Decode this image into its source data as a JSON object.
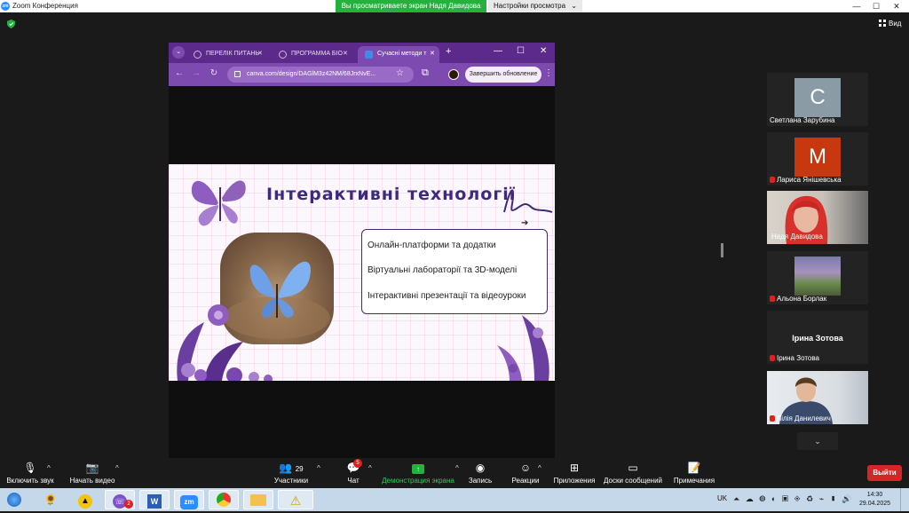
{
  "window": {
    "title": "Zoom Конференция",
    "share_banner": "Вы просматриваете экран Надя Давидова",
    "view_options": "Настройки просмотра",
    "minimize": "—",
    "maximize": "☐",
    "close": "✕"
  },
  "topbar": {
    "view_label": "Вид"
  },
  "browser": {
    "tabs": [
      {
        "label": "ПЕРЕЛІК ПИТАНЬ",
        "close": "✕"
      },
      {
        "label": "ПРОГРАММА БІО",
        "close": "✕"
      },
      {
        "label": "Сучасні методи т",
        "close": "✕"
      }
    ],
    "new_tab": "+",
    "url": "canva.com/design/DAGlM3z42NM/68JrxNvE...",
    "update_button": "Завершить обновление",
    "menu_dots": "⋮"
  },
  "slide": {
    "title": "Інтерактивні технології",
    "items": [
      "Онлайн-платформи та додатки",
      "Віртуальні лабораторії та 3D-моделі",
      "Інтерактивні презентації та відеоуроки"
    ],
    "colors": {
      "accent": "#6b3fa0",
      "title": "#3e2a7a"
    }
  },
  "participants": [
    {
      "name": "Светлана Зарубина",
      "initial": "С",
      "avatar_color": "#8a9ba6",
      "muted": false
    },
    {
      "name": "Лариса Янішевська",
      "initial": "М",
      "avatar_color": "#c8380e",
      "muted": true
    },
    {
      "name": "Надя Давидова",
      "muted": false,
      "active_speaker": true
    },
    {
      "name": "Альона Борлак",
      "muted": true
    },
    {
      "name": "Ірина Зотова",
      "display_text": "Ірина Зотова",
      "muted": true
    },
    {
      "name": "Лілія Данилевич",
      "muted": true
    }
  ],
  "toolbar": {
    "mute": "Включить звук",
    "video": "Начать видео",
    "participants": "Участники",
    "participants_count": "29",
    "chat": "Чат",
    "chat_badge": "5",
    "share": "Демонстрация экрана",
    "record": "Запись",
    "reactions": "Реакции",
    "apps": "Приложения",
    "whiteboards": "Доски сообщений",
    "notes": "Примечания",
    "leave": "Выйти"
  },
  "taskbar": {
    "lang": "UK",
    "time": "14:30",
    "date": "29.04.2025",
    "viber_badge": "2"
  }
}
